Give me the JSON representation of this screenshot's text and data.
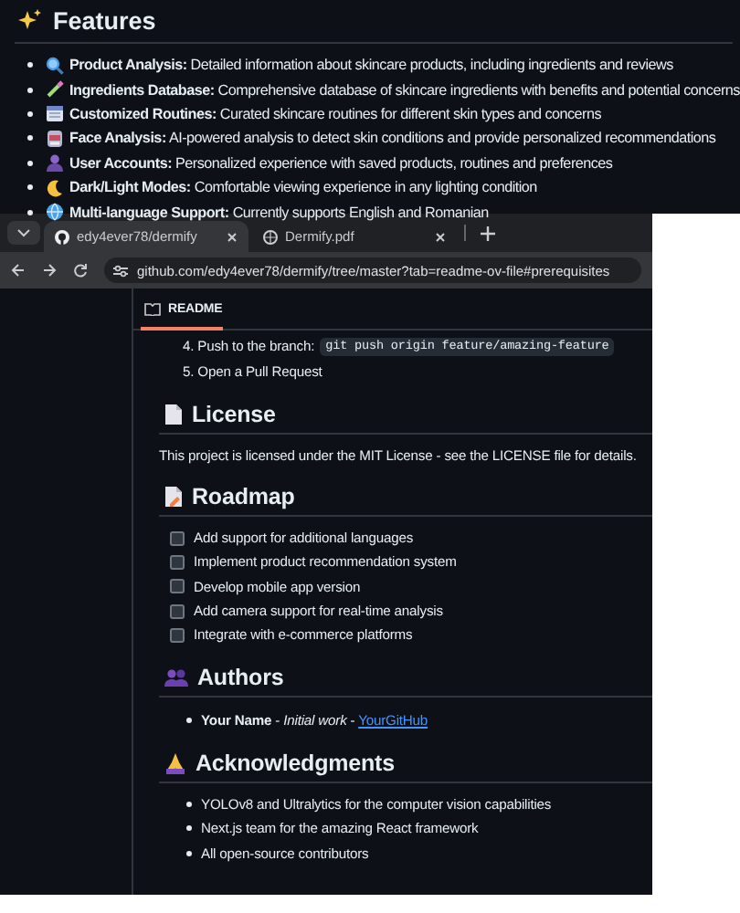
{
  "features": {
    "title": "Features",
    "items": [
      {
        "name": "Product Analysis:",
        "description": "Detailed information about skincare products, including ingredients and reviews"
      },
      {
        "name": "Ingredients Database:",
        "description": "Comprehensive database of skincare ingredients with benefits and potential concerns"
      },
      {
        "name": "Customized Routines:",
        "description": "Curated skincare routines for different skin types and concerns"
      },
      {
        "name": "Face Analysis:",
        "description": "AI-powered analysis to detect skin conditions and provide personalized recommendations"
      },
      {
        "name": "User Accounts:",
        "description": "Personalized experience with saved products, routines and preferences"
      },
      {
        "name": "Dark/Light Modes:",
        "description": "Comfortable viewing experience in any lighting condition"
      },
      {
        "name": "Multi-language Support:",
        "description": "Currently supports English and Romanian"
      }
    ]
  },
  "browser": {
    "tabs": [
      {
        "title": "edy4ever78/dermify",
        "selected": true
      },
      {
        "title": "Dermify.pdf",
        "selected": false
      }
    ],
    "url": "github.com/edy4ever78/dermify/tree/master?tab=readme-ov-file#prerequisites"
  },
  "readme": {
    "tab_label": "README",
    "steps": [
      {
        "number": "4.",
        "text": "Push to the branch:",
        "code": "git push origin feature/amazing-feature"
      },
      {
        "number": "5.",
        "text": "Open a Pull Request"
      }
    ],
    "license": {
      "title": "License",
      "text": "This project is licensed under the MIT License - see the LICENSE file for details."
    },
    "roadmap": {
      "title": "Roadmap",
      "items": [
        {
          "text": "Add support for additional languages",
          "checked": false
        },
        {
          "text": "Implement product recommendation system",
          "checked": false
        },
        {
          "text": "Develop mobile app version",
          "checked": false
        },
        {
          "text": "Add camera support for real-time analysis",
          "checked": false
        },
        {
          "text": "Integrate with e-commerce platforms",
          "checked": false
        }
      ]
    },
    "authors": {
      "title": "Authors",
      "items": [
        {
          "text": "**Your Name** - *Initial work* - ",
          "link": "YourGitHub"
        }
      ]
    },
    "acknowledgments": {
      "title": "Acknowledgments",
      "items": [
        "YOLOv8 and Ultralytics for the computer vision capabilities",
        "Next.js team for the amazing React framework",
        "All open-source contributors"
      ]
    }
  }
}
